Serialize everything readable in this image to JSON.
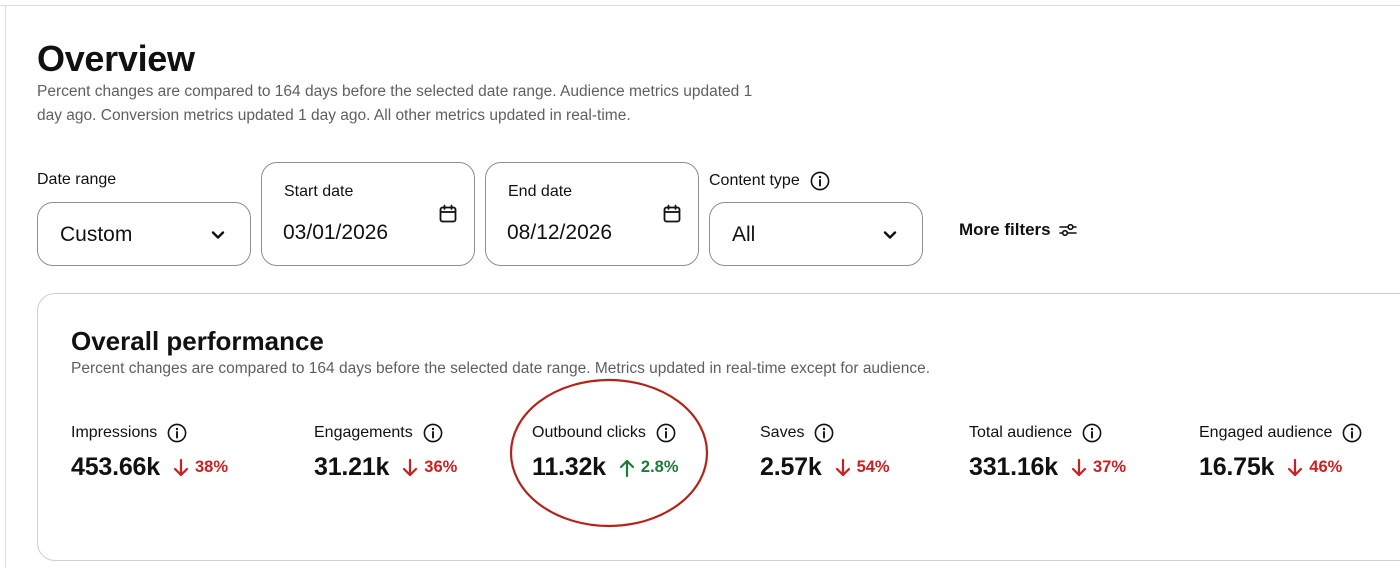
{
  "header": {
    "title": "Overview",
    "description": "Percent changes are compared to 164 days before the selected date range. Audience metrics updated 1 day ago. Conversion metrics updated 1 day ago. All other metrics updated in real-time."
  },
  "filters": {
    "date_range": {
      "label": "Date range",
      "value": "Custom"
    },
    "start_date": {
      "label": "Start date",
      "value": "03/01/2026"
    },
    "end_date": {
      "label": "End date",
      "value": "08/12/2026"
    },
    "content_type": {
      "label": "Content type",
      "value": "All"
    },
    "more_filters_label": "More filters"
  },
  "overall": {
    "title": "Overall performance",
    "description": "Percent changes are compared to 164 days before the selected date range. Metrics updated in real-time except for audience.",
    "metrics": [
      {
        "label": "Impressions",
        "value": "453.66k",
        "direction": "down",
        "change": "38%"
      },
      {
        "label": "Engagements",
        "value": "31.21k",
        "direction": "down",
        "change": "36%"
      },
      {
        "label": "Outbound clicks",
        "value": "11.32k",
        "direction": "up",
        "change": "2.8%"
      },
      {
        "label": "Saves",
        "value": "2.57k",
        "direction": "down",
        "change": "54%"
      },
      {
        "label": "Total audience",
        "value": "331.16k",
        "direction": "down",
        "change": "37%"
      },
      {
        "label": "Engaged audience",
        "value": "16.75k",
        "direction": "down",
        "change": "46%"
      }
    ]
  },
  "colors": {
    "down": "#cc1f1f",
    "up": "#1f7a3a",
    "highlight": "#b42318",
    "border": "#8f8f8f"
  },
  "icons": {
    "dropdown": "chevron-down-icon",
    "calendar": "calendar-icon",
    "info": "info-icon",
    "filters": "sliders-icon",
    "down": "arrow-down-icon",
    "up": "arrow-up-icon"
  }
}
